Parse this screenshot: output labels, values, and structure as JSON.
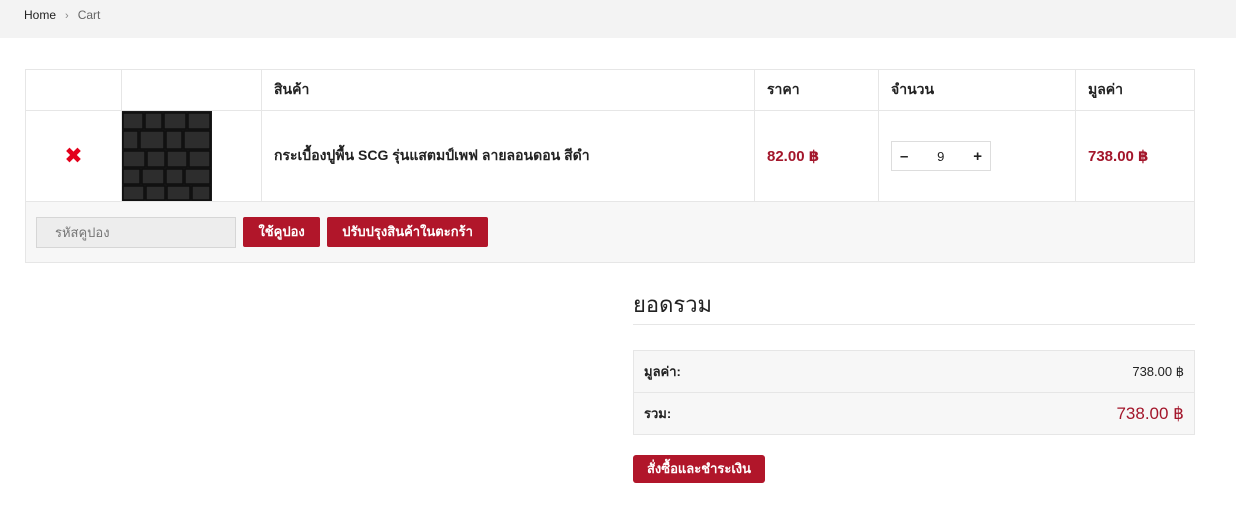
{
  "breadcrumb": {
    "home": "Home",
    "separator": "›",
    "current": "Cart"
  },
  "table": {
    "headers": {
      "product": "สินค้า",
      "price": "ราคา",
      "quantity": "จำนวน",
      "subtotal": "มูลค่า"
    },
    "rows": [
      {
        "remove": "✖",
        "name": "กระเบื้องปูพื้น SCG รุ่นแสตมป์เพฟ ลายลอนดอน สีดำ",
        "price": "82.00 ฿",
        "quantity": "9",
        "subtotal": "738.00 ฿"
      }
    ]
  },
  "qty_controls": {
    "minus": "–",
    "plus": "+"
  },
  "coupon": {
    "placeholder": "รหัสคูปอง",
    "apply_label": "ใช้คูปอง",
    "update_label": "ปรับปรุงสินค้าในตะกร้า"
  },
  "totals": {
    "title": "ยอดรวม",
    "subtotal_label": "มูลค่า:",
    "subtotal_value": "738.00 ฿",
    "total_label": "รวม:",
    "total_value": "738.00 ฿"
  },
  "checkout_label": "สั่งซื้อและชำระเงิน",
  "colors": {
    "accent": "#b1162a",
    "price_text": "#a3162b",
    "remove_x": "#e3001b"
  }
}
